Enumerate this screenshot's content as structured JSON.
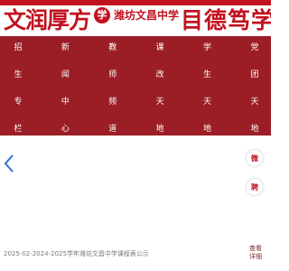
{
  "header": {
    "motto_left": "文润厚方",
    "emblem_glyph": "学",
    "school_name": "潍坊文昌中学",
    "motto_right": "目德笃学"
  },
  "nav": {
    "items": [
      {
        "chars": [
          "招",
          "生",
          "专",
          "栏"
        ]
      },
      {
        "chars": [
          "新",
          "闻",
          "中",
          "心"
        ]
      },
      {
        "chars": [
          "教",
          "师",
          "频",
          "道"
        ]
      },
      {
        "chars": [
          "课",
          "改",
          "天",
          "地"
        ]
      },
      {
        "chars": [
          "学",
          "生",
          "天",
          "地"
        ]
      },
      {
        "chars": [
          "党",
          "团",
          "天",
          "地"
        ]
      }
    ]
  },
  "floating": {
    "btn1": "微",
    "btn2": "聘"
  },
  "notice": {
    "text": "2025-02-2024-2025学年潍坊文昌中学课程表公示",
    "more_line1": "查看",
    "more_line2": "详细"
  },
  "colors": {
    "brand_red": "#c1121f",
    "banner_red": "#9b1e26"
  }
}
